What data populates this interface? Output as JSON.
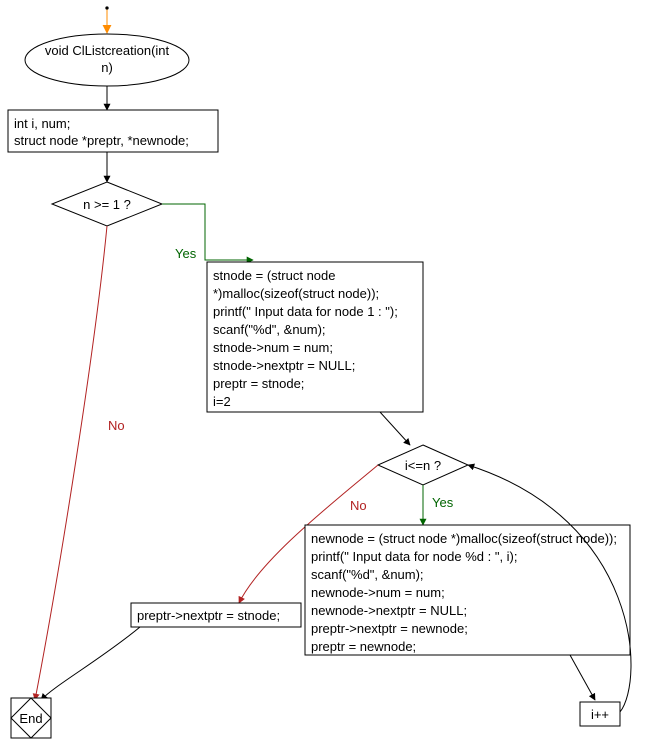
{
  "nodes": {
    "start": {
      "line1": "void ClListcreation(int",
      "line2": "n)"
    },
    "decl": {
      "line1": "int i, num;",
      "line2": "struct node *preptr, *newnode;"
    },
    "cond1": {
      "text": "n >= 1 ?"
    },
    "block1": {
      "l1": "stnode = (struct node",
      "l2": "*)malloc(sizeof(struct node));",
      "l3": "printf(\" Input data for node 1 : \");",
      "l4": "scanf(\"%d\", &num);",
      "l5": "stnode->num = num;",
      "l6": "stnode->nextptr = NULL;",
      "l7": "preptr = stnode;",
      "l8": "i=2"
    },
    "cond2": {
      "text": "i<=n ?"
    },
    "block2": {
      "l1": "newnode = (struct node *)malloc(sizeof(struct node));",
      "l2": "printf(\" Input data for node %d : \", i);",
      "l3": "scanf(\"%d\", &num);",
      "l4": "newnode->num = num;",
      "l5": "newnode->nextptr = NULL;",
      "l6": "preptr->nextptr = newnode;",
      "l7": "preptr = newnode;"
    },
    "incr": {
      "text": "i++"
    },
    "block3": {
      "text": "preptr->nextptr = stnode;"
    },
    "end": {
      "text": "End"
    }
  },
  "labels": {
    "yes": "Yes",
    "no": "No"
  }
}
